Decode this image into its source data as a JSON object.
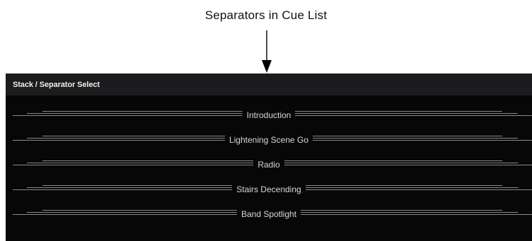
{
  "caption": "Separators in Cue List",
  "panel": {
    "title": "Stack / Separator Select"
  },
  "separators": [
    {
      "label": "Introduction"
    },
    {
      "label": "Lightening Scene Go"
    },
    {
      "label": "Radio"
    },
    {
      "label": "Stairs Decending"
    },
    {
      "label": "Band Spotlight"
    }
  ]
}
